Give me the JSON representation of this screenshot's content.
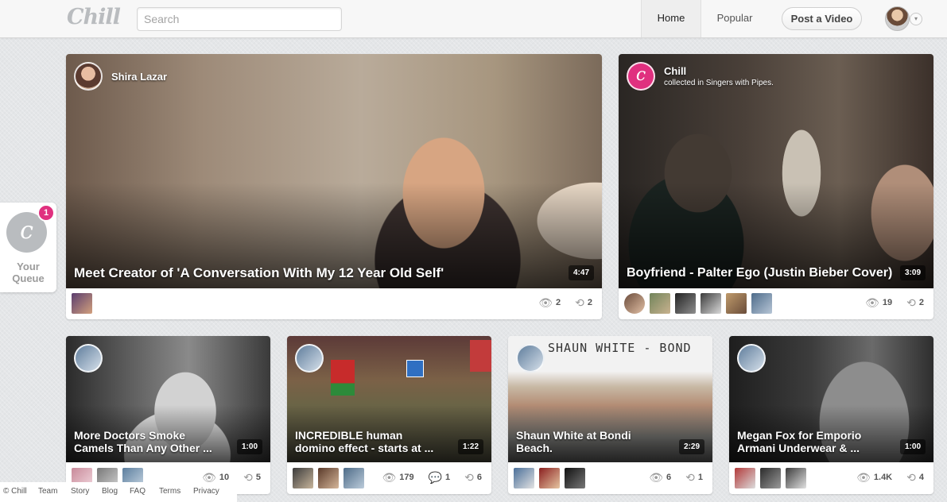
{
  "header": {
    "logo": "Chill",
    "search_placeholder": "Search",
    "nav_home": "Home",
    "nav_popular": "Popular",
    "post_button": "Post a Video",
    "caret": "▾"
  },
  "queue": {
    "badge": "1",
    "logo": "c",
    "label": "Your Queue"
  },
  "featured": [
    {
      "poster": "Shira Lazar",
      "title": "Meet Creator of 'A Conversation With My 12 Year Old Self'",
      "duration": "4:47",
      "views": "2",
      "shares": "2"
    },
    {
      "poster": "Chill",
      "poster_logo": "c",
      "subtitle": "collected in Singers with Pipes.",
      "title": "Boyfriend - Palter Ego (Justin Bieber Cover)",
      "duration": "3:09",
      "views": "19",
      "shares": "2"
    }
  ],
  "videos": [
    {
      "title": "More Doctors Smoke Camels Than Any Other ...",
      "duration": "1:00",
      "views": "10",
      "shares": "5"
    },
    {
      "title": "INCREDIBLE human domino effect - starts at ...",
      "duration": "1:22",
      "views": "179",
      "comments": "1",
      "shares": "6"
    },
    {
      "title": "Shaun White at Bondi Beach.",
      "duration": "2:29",
      "overlay_text": "SHAUN WHITE - BOND",
      "views": "6",
      "shares": "1"
    },
    {
      "title": "Megan Fox for Emporio Armani Underwear & ...",
      "duration": "1:00",
      "views": "1.4K",
      "shares": "4"
    }
  ],
  "footer": {
    "copyright": "© Chill",
    "links": [
      "Team",
      "Story",
      "Blog",
      "FAQ",
      "Terms",
      "Privacy"
    ]
  },
  "icons": {
    "views": "eye-icon",
    "shares": "repost-icon",
    "comments": "comment-icon"
  },
  "colors": {
    "accent": "#e0307f",
    "logo_gray": "#b9bcbf"
  }
}
